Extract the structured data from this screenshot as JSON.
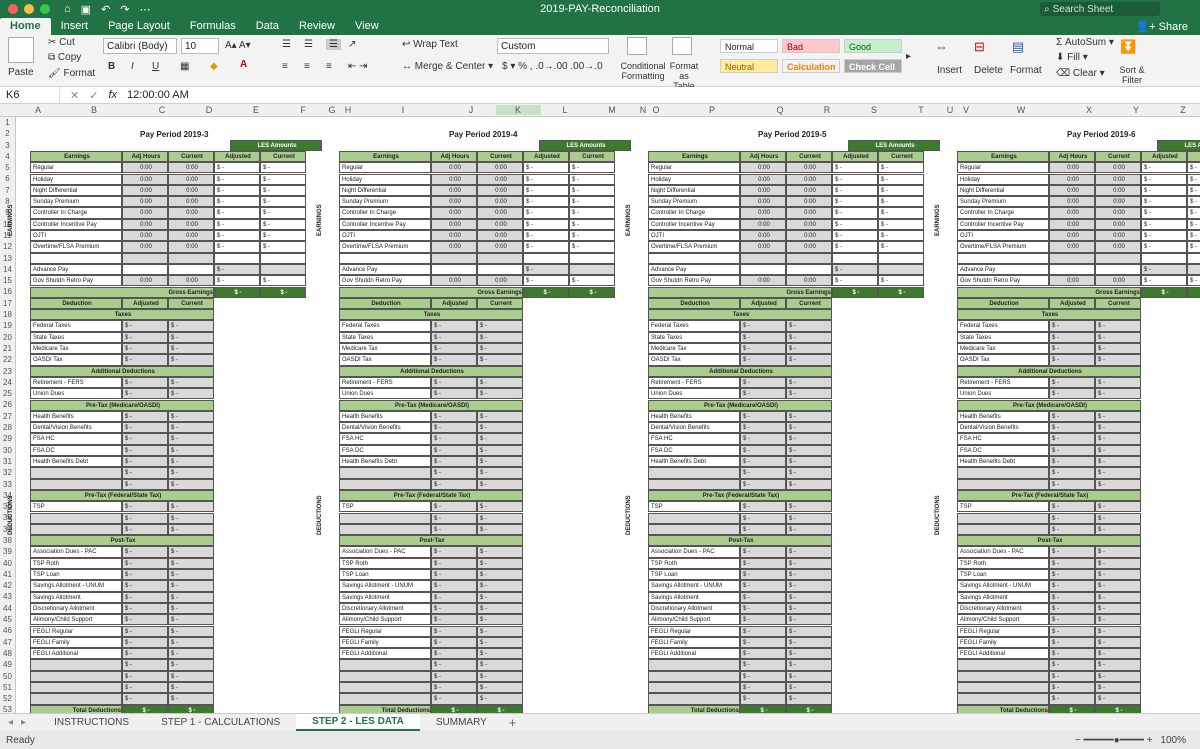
{
  "window": {
    "title": "2019-PAY-Reconciliation",
    "search_placeholder": "Search Sheet",
    "share_label": "Share"
  },
  "ribbon_tabs": [
    "Home",
    "Insert",
    "Page Layout",
    "Formulas",
    "Data",
    "Review",
    "View"
  ],
  "ribbon": {
    "paste": "Paste",
    "cut": "Cut",
    "copy": "Copy",
    "format": "Format",
    "font_name": "Calibri (Body)",
    "font_size": "10",
    "wrap_text": "Wrap Text",
    "merge_center": "Merge & Center",
    "number_format": "Custom",
    "conditional_formatting": "Conditional Formatting",
    "format_as_table": "Format as Table",
    "styles": [
      "Normal",
      "Bad",
      "Good",
      "Neutral",
      "Calculation",
      "Check Cell"
    ],
    "insert": "Insert",
    "delete": "Delete",
    "format_cells": "Format",
    "autosum": "AutoSum",
    "fill": "Fill",
    "clear": "Clear",
    "sort_filter": "Sort & Filter"
  },
  "formula_bar": {
    "cell_ref": "K6",
    "fx": "fx",
    "value": "12:00:00 AM"
  },
  "columns": [
    "A",
    "B",
    "C",
    "D",
    "E",
    "F",
    "G",
    "H",
    "I",
    "J",
    "K",
    "L",
    "M",
    "N",
    "O",
    "P",
    "Q",
    "R",
    "S",
    "T",
    "U",
    "V",
    "W",
    "X",
    "Y",
    "Z"
  ],
  "periods": [
    "Pay Period 2019-3",
    "Pay Period 2019-4",
    "Pay Period 2019-5",
    "Pay Period 2019-6"
  ],
  "labels": {
    "les_amounts": "LES Amounts",
    "earnings": "Earnings",
    "adj_hours": "Adj Hours",
    "current": "Current",
    "adjusted": "Adjusted",
    "deduction": "Deduction",
    "taxes": "Taxes",
    "additional_deductions": "Additional Deductions",
    "pretax_medicare": "Pre-Tax (Medicare/OASDI)",
    "pretax_federal": "Pre-Tax (Federal/State Tax)",
    "post_tax": "Post-Tax",
    "gross_earnings": "Gross Earnings",
    "total_deductions": "Total Deductions",
    "side_earnings": "EARNINGS",
    "side_deductions": "DEDUCTIONS",
    "zero_time": "0:00",
    "dollar": "$",
    "dash": "-"
  },
  "earnings_items": [
    "Regular",
    "Holiday",
    "Night Differential",
    "Sunday Premium",
    "Controller In Charge",
    "Controller Incentive Pay",
    "OJTI",
    "Overtime/FLSA Premium"
  ],
  "earnings_items_extra": [
    "Advance Pay",
    "Gov Shutdn Retro Pay"
  ],
  "tax_items": [
    "Federal Taxes",
    "State Taxes",
    "Medicare Tax",
    "OASDI Tax"
  ],
  "additional_items": [
    "Retirement - FERS",
    "Union Dues"
  ],
  "pretax_medicare_items": [
    "Health Benefits",
    "Dental/Vision Benefits",
    "FSA HC",
    "FSA DC",
    "Health Benefits Debt"
  ],
  "pretax_federal_items": [
    "TSP"
  ],
  "post_tax_items": [
    "Association Dues - PAC",
    "TSP Roth",
    "TSP Loan",
    "Savings Allotment - UNUM",
    "Savings Allotment",
    "Discretionary Allotment",
    "Alimony/Child Support",
    "FEGLI Regular",
    "FEGLI Family",
    "FEGLI Additional"
  ],
  "sheet_tabs": [
    "INSTRUCTIONS",
    "STEP 1 - CALCULATIONS",
    "STEP 2 - LES DATA",
    "SUMMARY"
  ],
  "active_sheet": "STEP 2 - LES DATA",
  "status": {
    "ready": "Ready",
    "zoom": "100%"
  },
  "colors": {
    "excel_green": "#217346",
    "header_green": "#a9cd8c",
    "les_dark_green": "#3c7a2c",
    "gray_cell": "#d9d9d9"
  }
}
